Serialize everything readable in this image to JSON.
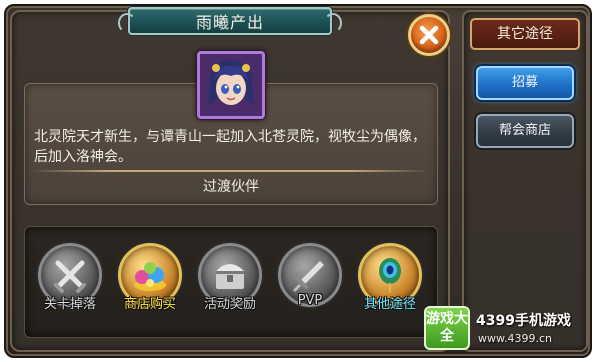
{
  "dialog": {
    "title": "雨曦产出",
    "description": "北灵院天才新生，与谭青山一起加入北苍灵院，视牧尘为偶像，后加入洛神会。",
    "category": "过渡伙伴",
    "portrait_icon": "character-portrait"
  },
  "sources": [
    {
      "label": "关卡掉落",
      "icon": "crossed-swords-icon",
      "color": "gray"
    },
    {
      "label": "商店购买",
      "icon": "treasure-pile-icon",
      "color": "yellow"
    },
    {
      "label": "活动奖励",
      "icon": "treasure-chest-icon",
      "color": "gray"
    },
    {
      "label": "PVP",
      "icon": "sword-icon",
      "color": "gray"
    },
    {
      "label": "其他途径",
      "icon": "peacock-feather-icon",
      "color": "cyan"
    }
  ],
  "side": {
    "title": "其它途径",
    "buttons": [
      "招募",
      "帮会商店"
    ]
  },
  "watermark": {
    "logo": "游戏大全",
    "brand": "4399手机游戏",
    "url": "www.4399.cn"
  },
  "colors": {
    "title_banner": "#1c4f52",
    "close_button": "#d8621a",
    "primary_button": "#1f70c8",
    "label_yellow": "#ffe14a",
    "label_cyan": "#6fe7ff"
  }
}
